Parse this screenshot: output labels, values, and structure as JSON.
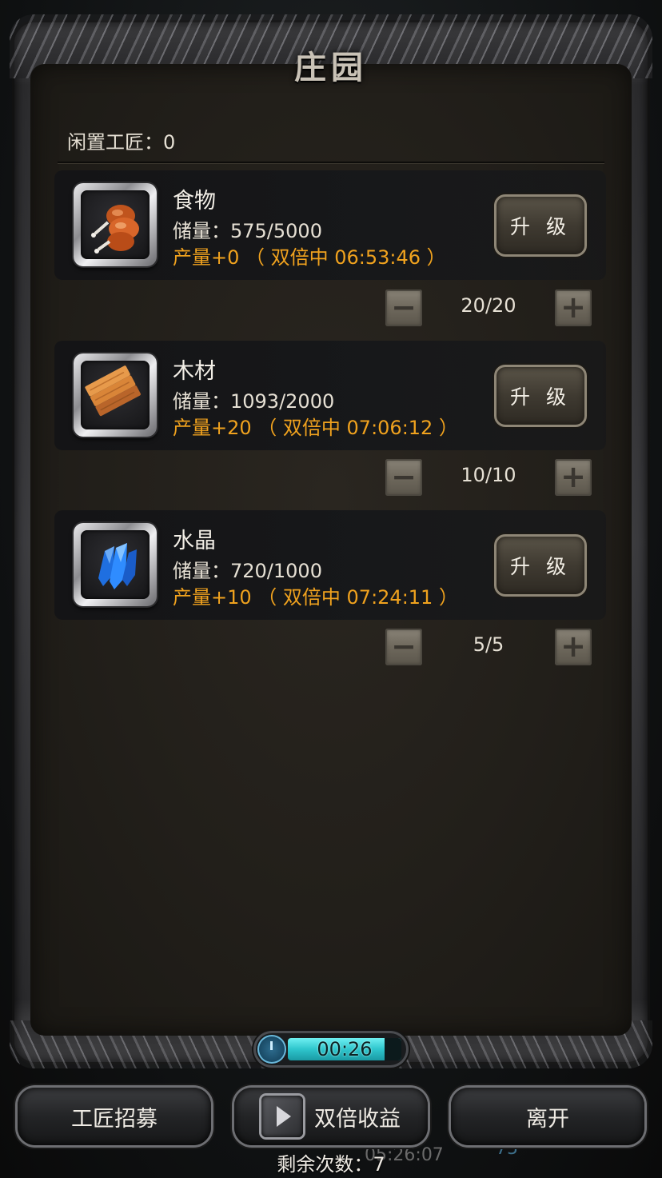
{
  "header": {
    "title": "庄园"
  },
  "idle_workers": {
    "label": "闲置工匠：0"
  },
  "resources": [
    {
      "icon": "meat-drumstick-icon",
      "name": "食物",
      "stock": "储量：575/5000",
      "production": "产量+0 （ 双倍中 06:53:46 ）",
      "upgrade_label": "升 级",
      "workers": "20/20"
    },
    {
      "icon": "wood-planks-icon",
      "name": "木材",
      "stock": "储量：1093/2000",
      "production": "产量+20 （ 双倍中 07:06:12 ）",
      "upgrade_label": "升 级",
      "workers": "10/10"
    },
    {
      "icon": "blue-crystal-icon",
      "name": "水晶",
      "stock": "储量：720/1000",
      "production": "产量+10 （ 双倍中 07:24:11 ）",
      "upgrade_label": "升 级",
      "workers": "5/5"
    }
  ],
  "stepper": {
    "minus": "−",
    "plus": "+"
  },
  "timer": {
    "text": "00:26",
    "fill": 0.85
  },
  "bottom": {
    "recruit_label": "工匠招募",
    "double_label": "双倍收益",
    "leave_label": "离开",
    "remaining": "剩余次数：7",
    "bg_time": "05:26:07",
    "bg_count": "75"
  },
  "colors": {
    "production": "#f0a21e",
    "timer": "#2ec5cc",
    "panel": "#221f1a"
  }
}
